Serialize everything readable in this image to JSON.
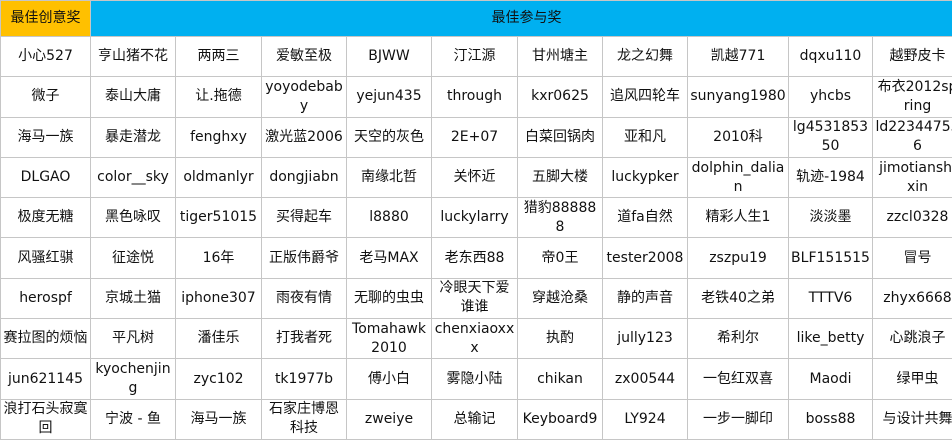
{
  "header": {
    "creative_award": "最佳创意奖",
    "participation_award": "最佳参与奖"
  },
  "colors": {
    "creative_header": "#ffc000",
    "participation_header": "#00b0f0",
    "grid": "#c6c6c6"
  },
  "rows": [
    [
      "小心527",
      "亨山猪不花",
      "两两三",
      "爱敏至极",
      "BJWW",
      "汀江源",
      "甘州塘主",
      "龙之幻舞",
      "凯越771",
      "dqxu110",
      "越野皮卡"
    ],
    [
      "微子",
      "泰山大庸",
      "让.拖德",
      "yoyodebaby",
      "yejun435",
      "through",
      "kxr0625",
      "追风四轮车",
      "sunyang1980",
      "yhcbs",
      "布衣2012spring"
    ],
    [
      "海马一族",
      "暴走潜龙",
      "fenghxy",
      "激光蓝2006",
      "天空的灰色",
      "2E+07",
      "白菜回锅肉",
      "亚和凡",
      "2010科",
      "lg453185350",
      "ld223447556"
    ],
    [
      "DLGAO",
      "color__sky",
      "oldmanlyr",
      "dongjiabn",
      "南缘北哲",
      "关怀近",
      "五脚大楼",
      "luckypker",
      "dolphin_dalian",
      "轨迹-1984",
      "jimotianshixin"
    ],
    [
      "极度无糖",
      "黑色咏叹",
      "tiger51015",
      "买得起车",
      "l8880",
      "luckylarry",
      "猎豹888888",
      "道fa自然",
      "精彩人生1",
      "淡淡墨",
      "zzcl0328"
    ],
    [
      "风骚红骐",
      "征途悦",
      "16年",
      "正版伟爵爷",
      "老马MAX",
      "老东西88",
      "帝0王",
      "tester2008",
      "zszpu19",
      "BLF151515",
      "冒号"
    ],
    [
      "herospf",
      "京城土猫",
      "iphone307",
      "雨夜有情",
      "无聊的虫虫",
      "冷眼天下爱谁谁",
      "穿越沧桑",
      "静的声音",
      "老铁40之弟",
      "TTTV6",
      "zhyx6668"
    ],
    [
      "赛拉图的烦恼",
      "平凡树",
      "潘佳乐",
      "打我者死",
      "Tomahawk2010",
      "chenxiaoxxx",
      "执酌",
      "jully123",
      "希利尔",
      "like_betty",
      "心跳浪子"
    ],
    [
      "jun621145",
      "kyochenjing",
      "zyc102",
      "tk1977b",
      "傅小白",
      "雾隐小陆",
      "chikan",
      "zx00544",
      "一包红双喜",
      "Maodi",
      "绿甲虫"
    ],
    [
      "浪打石头寂寞回",
      "宁波 - 鱼",
      "海马一族",
      "石家庄博恩科技",
      "zweiye",
      "总输记",
      "Keyboard9",
      "LY924",
      "一步一脚印",
      "boss88",
      "与设计共舞"
    ]
  ]
}
